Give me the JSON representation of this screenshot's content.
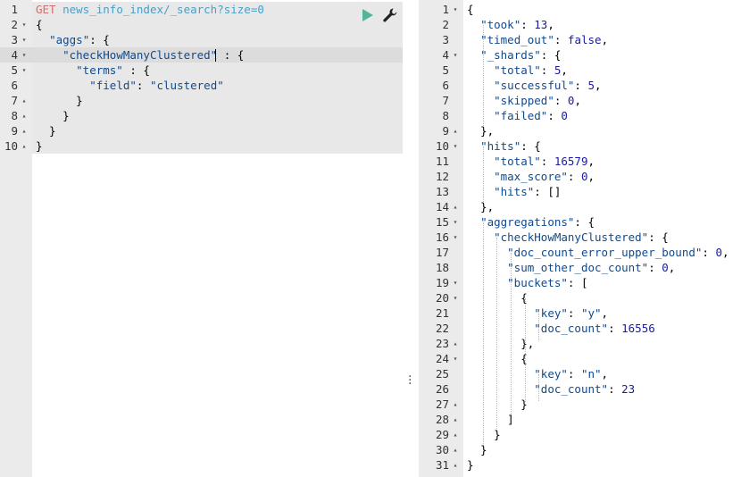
{
  "request": {
    "lines": [
      {
        "n": "1",
        "fold": "",
        "tokens": [
          {
            "c": "k-method",
            "t": "GET"
          },
          {
            "c": "",
            "t": " "
          },
          {
            "c": "k-url",
            "t": "news_info_index/_search?size=0"
          }
        ]
      },
      {
        "n": "2",
        "fold": "▾",
        "tokens": [
          {
            "c": "",
            "t": "{"
          }
        ]
      },
      {
        "n": "3",
        "fold": "▾",
        "tokens": [
          {
            "c": "",
            "t": "  "
          },
          {
            "c": "k-str",
            "t": "\"aggs\""
          },
          {
            "c": "",
            "t": ": {"
          }
        ]
      },
      {
        "n": "4",
        "fold": "▾",
        "tokens": [
          {
            "c": "",
            "t": "    "
          },
          {
            "c": "k-str",
            "t": "\"checkHowManyClustered\""
          },
          {
            "c": "",
            "t": " : {"
          }
        ]
      },
      {
        "n": "5",
        "fold": "▾",
        "tokens": [
          {
            "c": "",
            "t": "      "
          },
          {
            "c": "k-str",
            "t": "\"terms\""
          },
          {
            "c": "",
            "t": " : {"
          }
        ]
      },
      {
        "n": "6",
        "fold": "",
        "tokens": [
          {
            "c": "",
            "t": "        "
          },
          {
            "c": "k-str",
            "t": "\"field\""
          },
          {
            "c": "",
            "t": ": "
          },
          {
            "c": "k-str",
            "t": "\"clustered\""
          }
        ]
      },
      {
        "n": "7",
        "fold": "▴",
        "tokens": [
          {
            "c": "",
            "t": "      }"
          }
        ]
      },
      {
        "n": "8",
        "fold": "▴",
        "tokens": [
          {
            "c": "",
            "t": "    }"
          }
        ]
      },
      {
        "n": "9",
        "fold": "▴",
        "tokens": [
          {
            "c": "",
            "t": "  }"
          }
        ]
      },
      {
        "n": "10",
        "fold": "▴",
        "tokens": [
          {
            "c": "",
            "t": "}"
          }
        ]
      }
    ]
  },
  "response": {
    "lines": [
      {
        "n": "1",
        "fold": "▾",
        "tokens": [
          {
            "c": "",
            "t": "{"
          }
        ]
      },
      {
        "n": "2",
        "fold": "",
        "tokens": [
          {
            "c": "",
            "t": "  "
          },
          {
            "c": "k-str",
            "t": "\"took\""
          },
          {
            "c": "",
            "t": ": "
          },
          {
            "c": "k-num",
            "t": "13"
          },
          {
            "c": "",
            "t": ","
          }
        ]
      },
      {
        "n": "3",
        "fold": "",
        "tokens": [
          {
            "c": "",
            "t": "  "
          },
          {
            "c": "k-str",
            "t": "\"timed_out\""
          },
          {
            "c": "",
            "t": ": "
          },
          {
            "c": "k-bool",
            "t": "false"
          },
          {
            "c": "",
            "t": ","
          }
        ]
      },
      {
        "n": "4",
        "fold": "▾",
        "tokens": [
          {
            "c": "",
            "t": "  "
          },
          {
            "c": "k-str",
            "t": "\"_shards\""
          },
          {
            "c": "",
            "t": ": {"
          }
        ]
      },
      {
        "n": "5",
        "fold": "",
        "tokens": [
          {
            "c": "",
            "t": "    "
          },
          {
            "c": "k-str",
            "t": "\"total\""
          },
          {
            "c": "",
            "t": ": "
          },
          {
            "c": "k-num",
            "t": "5"
          },
          {
            "c": "",
            "t": ","
          }
        ]
      },
      {
        "n": "6",
        "fold": "",
        "tokens": [
          {
            "c": "",
            "t": "    "
          },
          {
            "c": "k-str",
            "t": "\"successful\""
          },
          {
            "c": "",
            "t": ": "
          },
          {
            "c": "k-num",
            "t": "5"
          },
          {
            "c": "",
            "t": ","
          }
        ]
      },
      {
        "n": "7",
        "fold": "",
        "tokens": [
          {
            "c": "",
            "t": "    "
          },
          {
            "c": "k-str",
            "t": "\"skipped\""
          },
          {
            "c": "",
            "t": ": "
          },
          {
            "c": "k-num",
            "t": "0"
          },
          {
            "c": "",
            "t": ","
          }
        ]
      },
      {
        "n": "8",
        "fold": "",
        "tokens": [
          {
            "c": "",
            "t": "    "
          },
          {
            "c": "k-str",
            "t": "\"failed\""
          },
          {
            "c": "",
            "t": ": "
          },
          {
            "c": "k-num",
            "t": "0"
          }
        ]
      },
      {
        "n": "9",
        "fold": "▴",
        "tokens": [
          {
            "c": "",
            "t": "  },"
          }
        ]
      },
      {
        "n": "10",
        "fold": "▾",
        "tokens": [
          {
            "c": "",
            "t": "  "
          },
          {
            "c": "k-str",
            "t": "\"hits\""
          },
          {
            "c": "",
            "t": ": {"
          }
        ]
      },
      {
        "n": "11",
        "fold": "",
        "tokens": [
          {
            "c": "",
            "t": "    "
          },
          {
            "c": "k-str",
            "t": "\"total\""
          },
          {
            "c": "",
            "t": ": "
          },
          {
            "c": "k-num",
            "t": "16579"
          },
          {
            "c": "",
            "t": ","
          }
        ]
      },
      {
        "n": "12",
        "fold": "",
        "tokens": [
          {
            "c": "",
            "t": "    "
          },
          {
            "c": "k-str",
            "t": "\"max_score\""
          },
          {
            "c": "",
            "t": ": "
          },
          {
            "c": "k-num",
            "t": "0"
          },
          {
            "c": "",
            "t": ","
          }
        ]
      },
      {
        "n": "13",
        "fold": "",
        "tokens": [
          {
            "c": "",
            "t": "    "
          },
          {
            "c": "k-str",
            "t": "\"hits\""
          },
          {
            "c": "",
            "t": ": []"
          }
        ]
      },
      {
        "n": "14",
        "fold": "▴",
        "tokens": [
          {
            "c": "",
            "t": "  },"
          }
        ]
      },
      {
        "n": "15",
        "fold": "▾",
        "tokens": [
          {
            "c": "",
            "t": "  "
          },
          {
            "c": "k-str",
            "t": "\"aggregations\""
          },
          {
            "c": "",
            "t": ": {"
          }
        ]
      },
      {
        "n": "16",
        "fold": "▾",
        "tokens": [
          {
            "c": "",
            "t": "    "
          },
          {
            "c": "k-str",
            "t": "\"checkHowManyClustered\""
          },
          {
            "c": "",
            "t": ": {"
          }
        ]
      },
      {
        "n": "17",
        "fold": "",
        "tokens": [
          {
            "c": "",
            "t": "      "
          },
          {
            "c": "k-str",
            "t": "\"doc_count_error_upper_bound\""
          },
          {
            "c": "",
            "t": ": "
          },
          {
            "c": "k-num",
            "t": "0"
          },
          {
            "c": "",
            "t": ","
          }
        ]
      },
      {
        "n": "18",
        "fold": "",
        "tokens": [
          {
            "c": "",
            "t": "      "
          },
          {
            "c": "k-str",
            "t": "\"sum_other_doc_count\""
          },
          {
            "c": "",
            "t": ": "
          },
          {
            "c": "k-num",
            "t": "0"
          },
          {
            "c": "",
            "t": ","
          }
        ]
      },
      {
        "n": "19",
        "fold": "▾",
        "tokens": [
          {
            "c": "",
            "t": "      "
          },
          {
            "c": "k-str",
            "t": "\"buckets\""
          },
          {
            "c": "",
            "t": ": ["
          }
        ]
      },
      {
        "n": "20",
        "fold": "▾",
        "tokens": [
          {
            "c": "",
            "t": "        {"
          }
        ]
      },
      {
        "n": "21",
        "fold": "",
        "tokens": [
          {
            "c": "",
            "t": "          "
          },
          {
            "c": "k-str",
            "t": "\"key\""
          },
          {
            "c": "",
            "t": ": "
          },
          {
            "c": "k-str",
            "t": "\"y\""
          },
          {
            "c": "",
            "t": ","
          }
        ]
      },
      {
        "n": "22",
        "fold": "",
        "tokens": [
          {
            "c": "",
            "t": "          "
          },
          {
            "c": "k-str",
            "t": "\"doc_count\""
          },
          {
            "c": "",
            "t": ": "
          },
          {
            "c": "k-num",
            "t": "16556"
          }
        ]
      },
      {
        "n": "23",
        "fold": "▴",
        "tokens": [
          {
            "c": "",
            "t": "        },"
          }
        ]
      },
      {
        "n": "24",
        "fold": "▾",
        "tokens": [
          {
            "c": "",
            "t": "        {"
          }
        ]
      },
      {
        "n": "25",
        "fold": "",
        "tokens": [
          {
            "c": "",
            "t": "          "
          },
          {
            "c": "k-str",
            "t": "\"key\""
          },
          {
            "c": "",
            "t": ": "
          },
          {
            "c": "k-str",
            "t": "\"n\""
          },
          {
            "c": "",
            "t": ","
          }
        ]
      },
      {
        "n": "26",
        "fold": "",
        "tokens": [
          {
            "c": "",
            "t": "          "
          },
          {
            "c": "k-str",
            "t": "\"doc_count\""
          },
          {
            "c": "",
            "t": ": "
          },
          {
            "c": "k-num",
            "t": "23"
          }
        ]
      },
      {
        "n": "27",
        "fold": "▴",
        "tokens": [
          {
            "c": "",
            "t": "        }"
          }
        ]
      },
      {
        "n": "28",
        "fold": "▴",
        "tokens": [
          {
            "c": "",
            "t": "      ]"
          }
        ]
      },
      {
        "n": "29",
        "fold": "▴",
        "tokens": [
          {
            "c": "",
            "t": "    }"
          }
        ]
      },
      {
        "n": "30",
        "fold": "▴",
        "tokens": [
          {
            "c": "",
            "t": "  }"
          }
        ]
      },
      {
        "n": "31",
        "fold": "▴",
        "tokens": [
          {
            "c": "",
            "t": "}"
          }
        ]
      }
    ]
  },
  "toolbar": {
    "run_icon": "play-icon",
    "settings_icon": "wrench-icon",
    "accent": "#54b399"
  },
  "resizer_icon": "vertical-ellipsis-icon"
}
